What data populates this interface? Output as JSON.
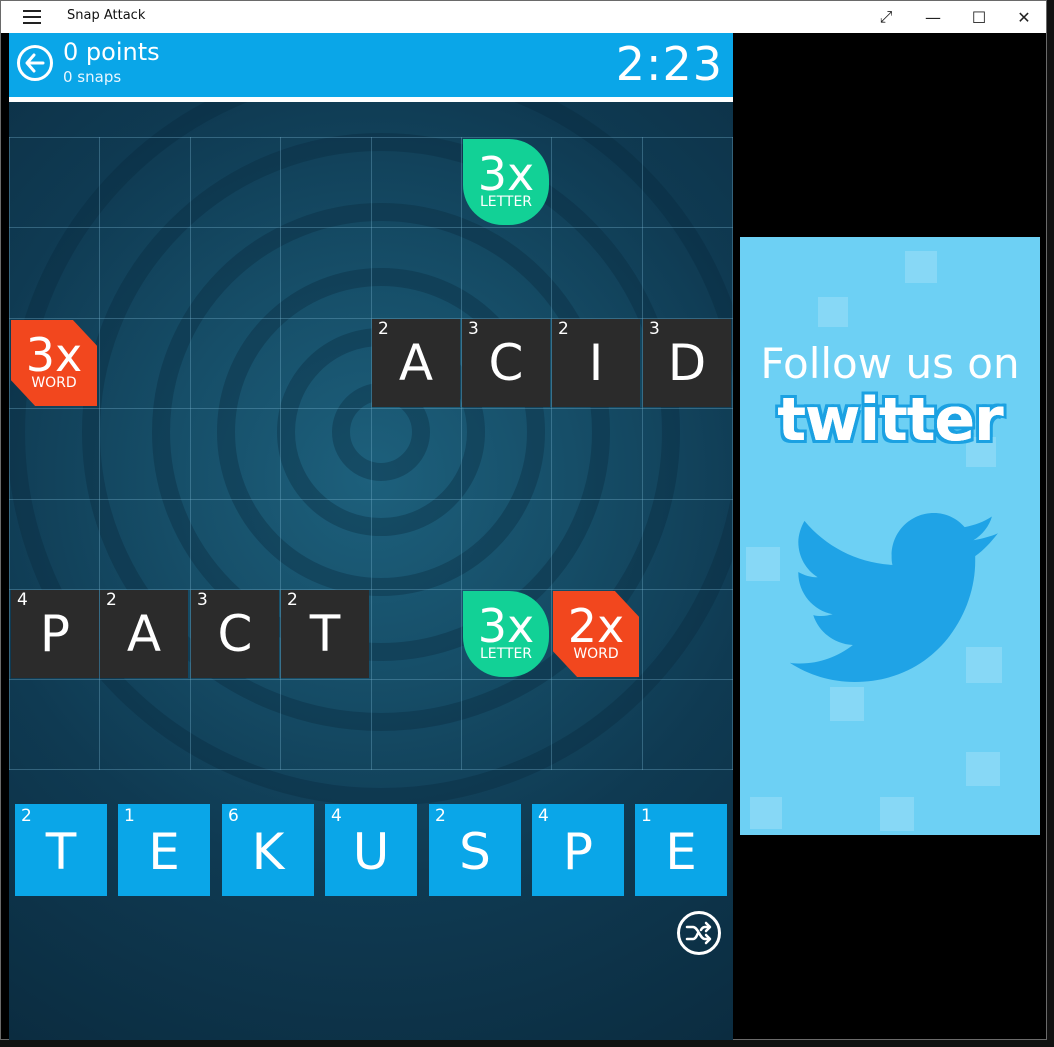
{
  "window": {
    "title": "Snap Attack",
    "buttons": {
      "fullscreen": "⤢",
      "minimize": "—",
      "maximize": "☐",
      "close": "✕"
    }
  },
  "header": {
    "points": "0 points",
    "snaps": "0 snaps",
    "timer": "2:23"
  },
  "board": {
    "bonus": {
      "b1": {
        "mult": "3x",
        "kind": "LETTER"
      },
      "b2": {
        "mult": "3x",
        "kind": "WORD"
      },
      "b3": {
        "mult": "3x",
        "kind": "LETTER"
      },
      "b4": {
        "mult": "2x",
        "kind": "WORD"
      }
    },
    "words": {
      "acid": [
        {
          "letter": "A",
          "value": "2"
        },
        {
          "letter": "C",
          "value": "3"
        },
        {
          "letter": "I",
          "value": "2"
        },
        {
          "letter": "D",
          "value": "3"
        }
      ],
      "pact": [
        {
          "letter": "P",
          "value": "4"
        },
        {
          "letter": "A",
          "value": "2"
        },
        {
          "letter": "C",
          "value": "3"
        },
        {
          "letter": "T",
          "value": "2"
        }
      ]
    }
  },
  "rack": [
    {
      "letter": "T",
      "value": "2"
    },
    {
      "letter": "E",
      "value": "1"
    },
    {
      "letter": "K",
      "value": "6"
    },
    {
      "letter": "U",
      "value": "4"
    },
    {
      "letter": "S",
      "value": "2"
    },
    {
      "letter": "P",
      "value": "4"
    },
    {
      "letter": "E",
      "value": "1"
    }
  ],
  "ad": {
    "line1": "Follow us on",
    "line2": "twitter"
  },
  "colors": {
    "accent": "#0aa6e8",
    "letter_bonus": "#12d196",
    "word_bonus": "#f2471e",
    "tile": "#2b2b2b"
  },
  "icons": {
    "back": "back-arrow-icon",
    "shuffle": "shuffle-icon",
    "menu": "hamburger-icon",
    "bird": "twitter-bird-icon"
  }
}
